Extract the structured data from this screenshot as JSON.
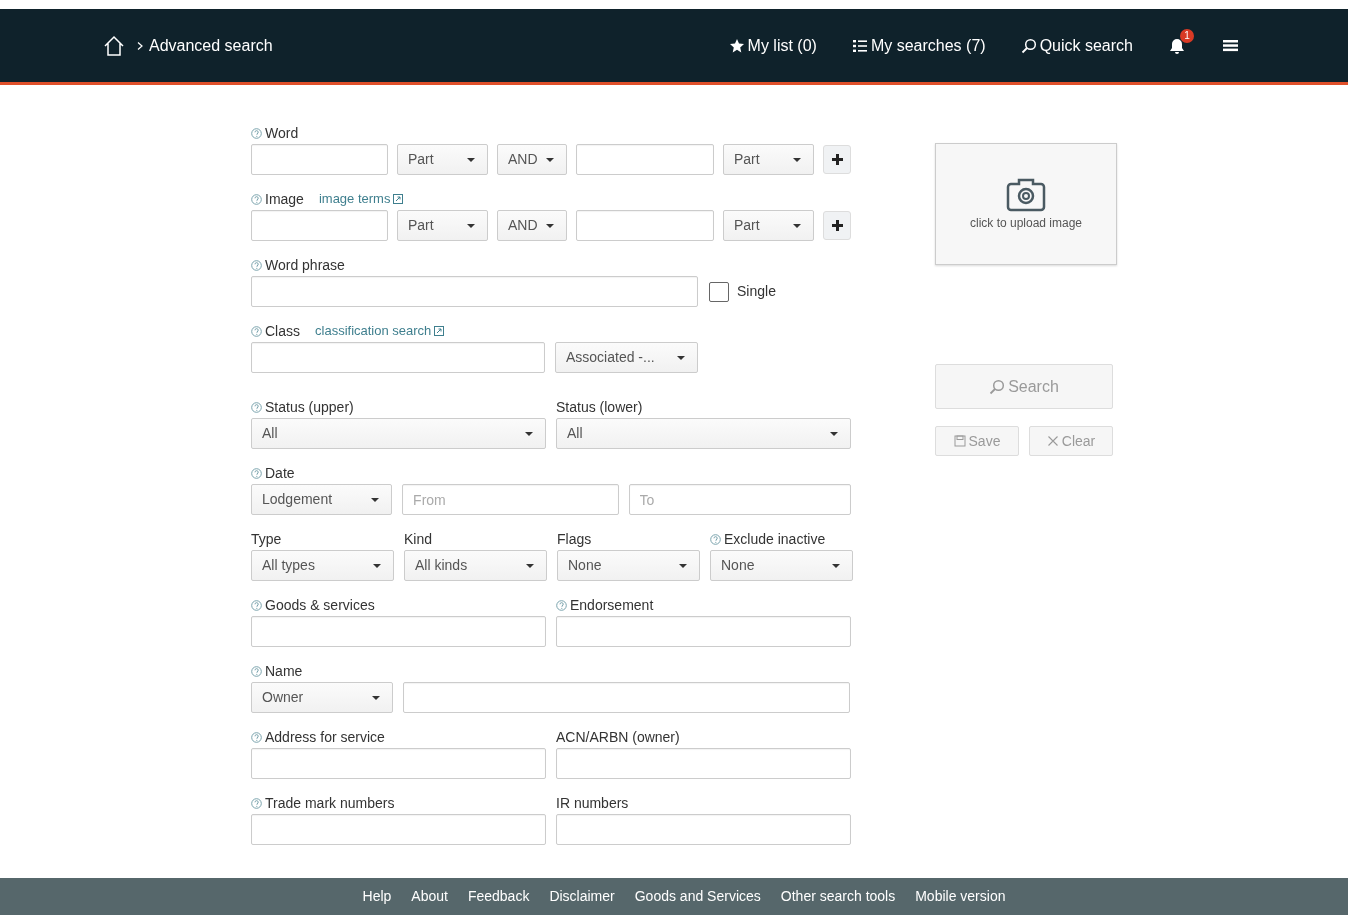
{
  "header": {
    "breadcrumb": "Advanced search",
    "nav": [
      "My list (0)",
      "My searches (7)",
      "Quick search"
    ],
    "badge": "1"
  },
  "rows": [
    {
      "kind": "terms",
      "label": "Word",
      "help": true,
      "first_mode": "Part",
      "operator": "AND",
      "second_mode": "Part"
    },
    {
      "kind": "terms",
      "label": "Image",
      "help": true,
      "link": "image terms",
      "first_mode": "Part",
      "operator": "AND",
      "second_mode": "Part"
    },
    {
      "kind": "phrase",
      "label": "Word phrase",
      "help": true,
      "checkbox": {
        "label": "Single",
        "checked": false
      }
    },
    {
      "kind": "class",
      "label": "Class",
      "help": true,
      "link": "classification search",
      "select": "Associated -..."
    },
    {
      "kind": "pair",
      "items": [
        {
          "label": "Status (upper)",
          "help": true,
          "select": "All"
        },
        {
          "label": "Status (lower)",
          "help": false,
          "select": "All"
        }
      ]
    },
    {
      "kind": "date",
      "label": "Date",
      "help": true,
      "select": "Lodgement",
      "from_placeholder": "From",
      "to_placeholder": "To"
    },
    {
      "kind": "quad",
      "items": [
        {
          "label": "Type",
          "help": false,
          "select": "All types"
        },
        {
          "label": "Kind",
          "help": false,
          "select": "All kinds"
        },
        {
          "label": "Flags",
          "help": false,
          "select": "None"
        },
        {
          "label": "Exclude inactive",
          "help": true,
          "select": "None"
        }
      ]
    },
    {
      "kind": "pair",
      "items": [
        {
          "label": "Goods & services",
          "help": true
        },
        {
          "label": "Endorsement",
          "help": true
        }
      ]
    },
    {
      "kind": "name",
      "label": "Name",
      "help": true,
      "select": "Owner"
    },
    {
      "kind": "pair",
      "items": [
        {
          "label": "Address for service",
          "help": true
        },
        {
          "label": "ACN/ARBN (owner)",
          "help": false
        }
      ]
    },
    {
      "kind": "pair",
      "items": [
        {
          "label": "Trade mark numbers",
          "help": true
        },
        {
          "label": "IR numbers",
          "help": false
        }
      ]
    }
  ],
  "upload": {
    "text": "click to upload image"
  },
  "actions": {
    "search": {
      "label": "Search",
      "disabled": true
    },
    "save": {
      "label": "Save",
      "disabled": true
    },
    "clear": {
      "label": "Clear",
      "disabled": true
    }
  },
  "footer": [
    "Help",
    "About",
    "Feedback",
    "Disclaimer",
    "Goods and Services",
    "Other search tools",
    "Mobile version"
  ]
}
